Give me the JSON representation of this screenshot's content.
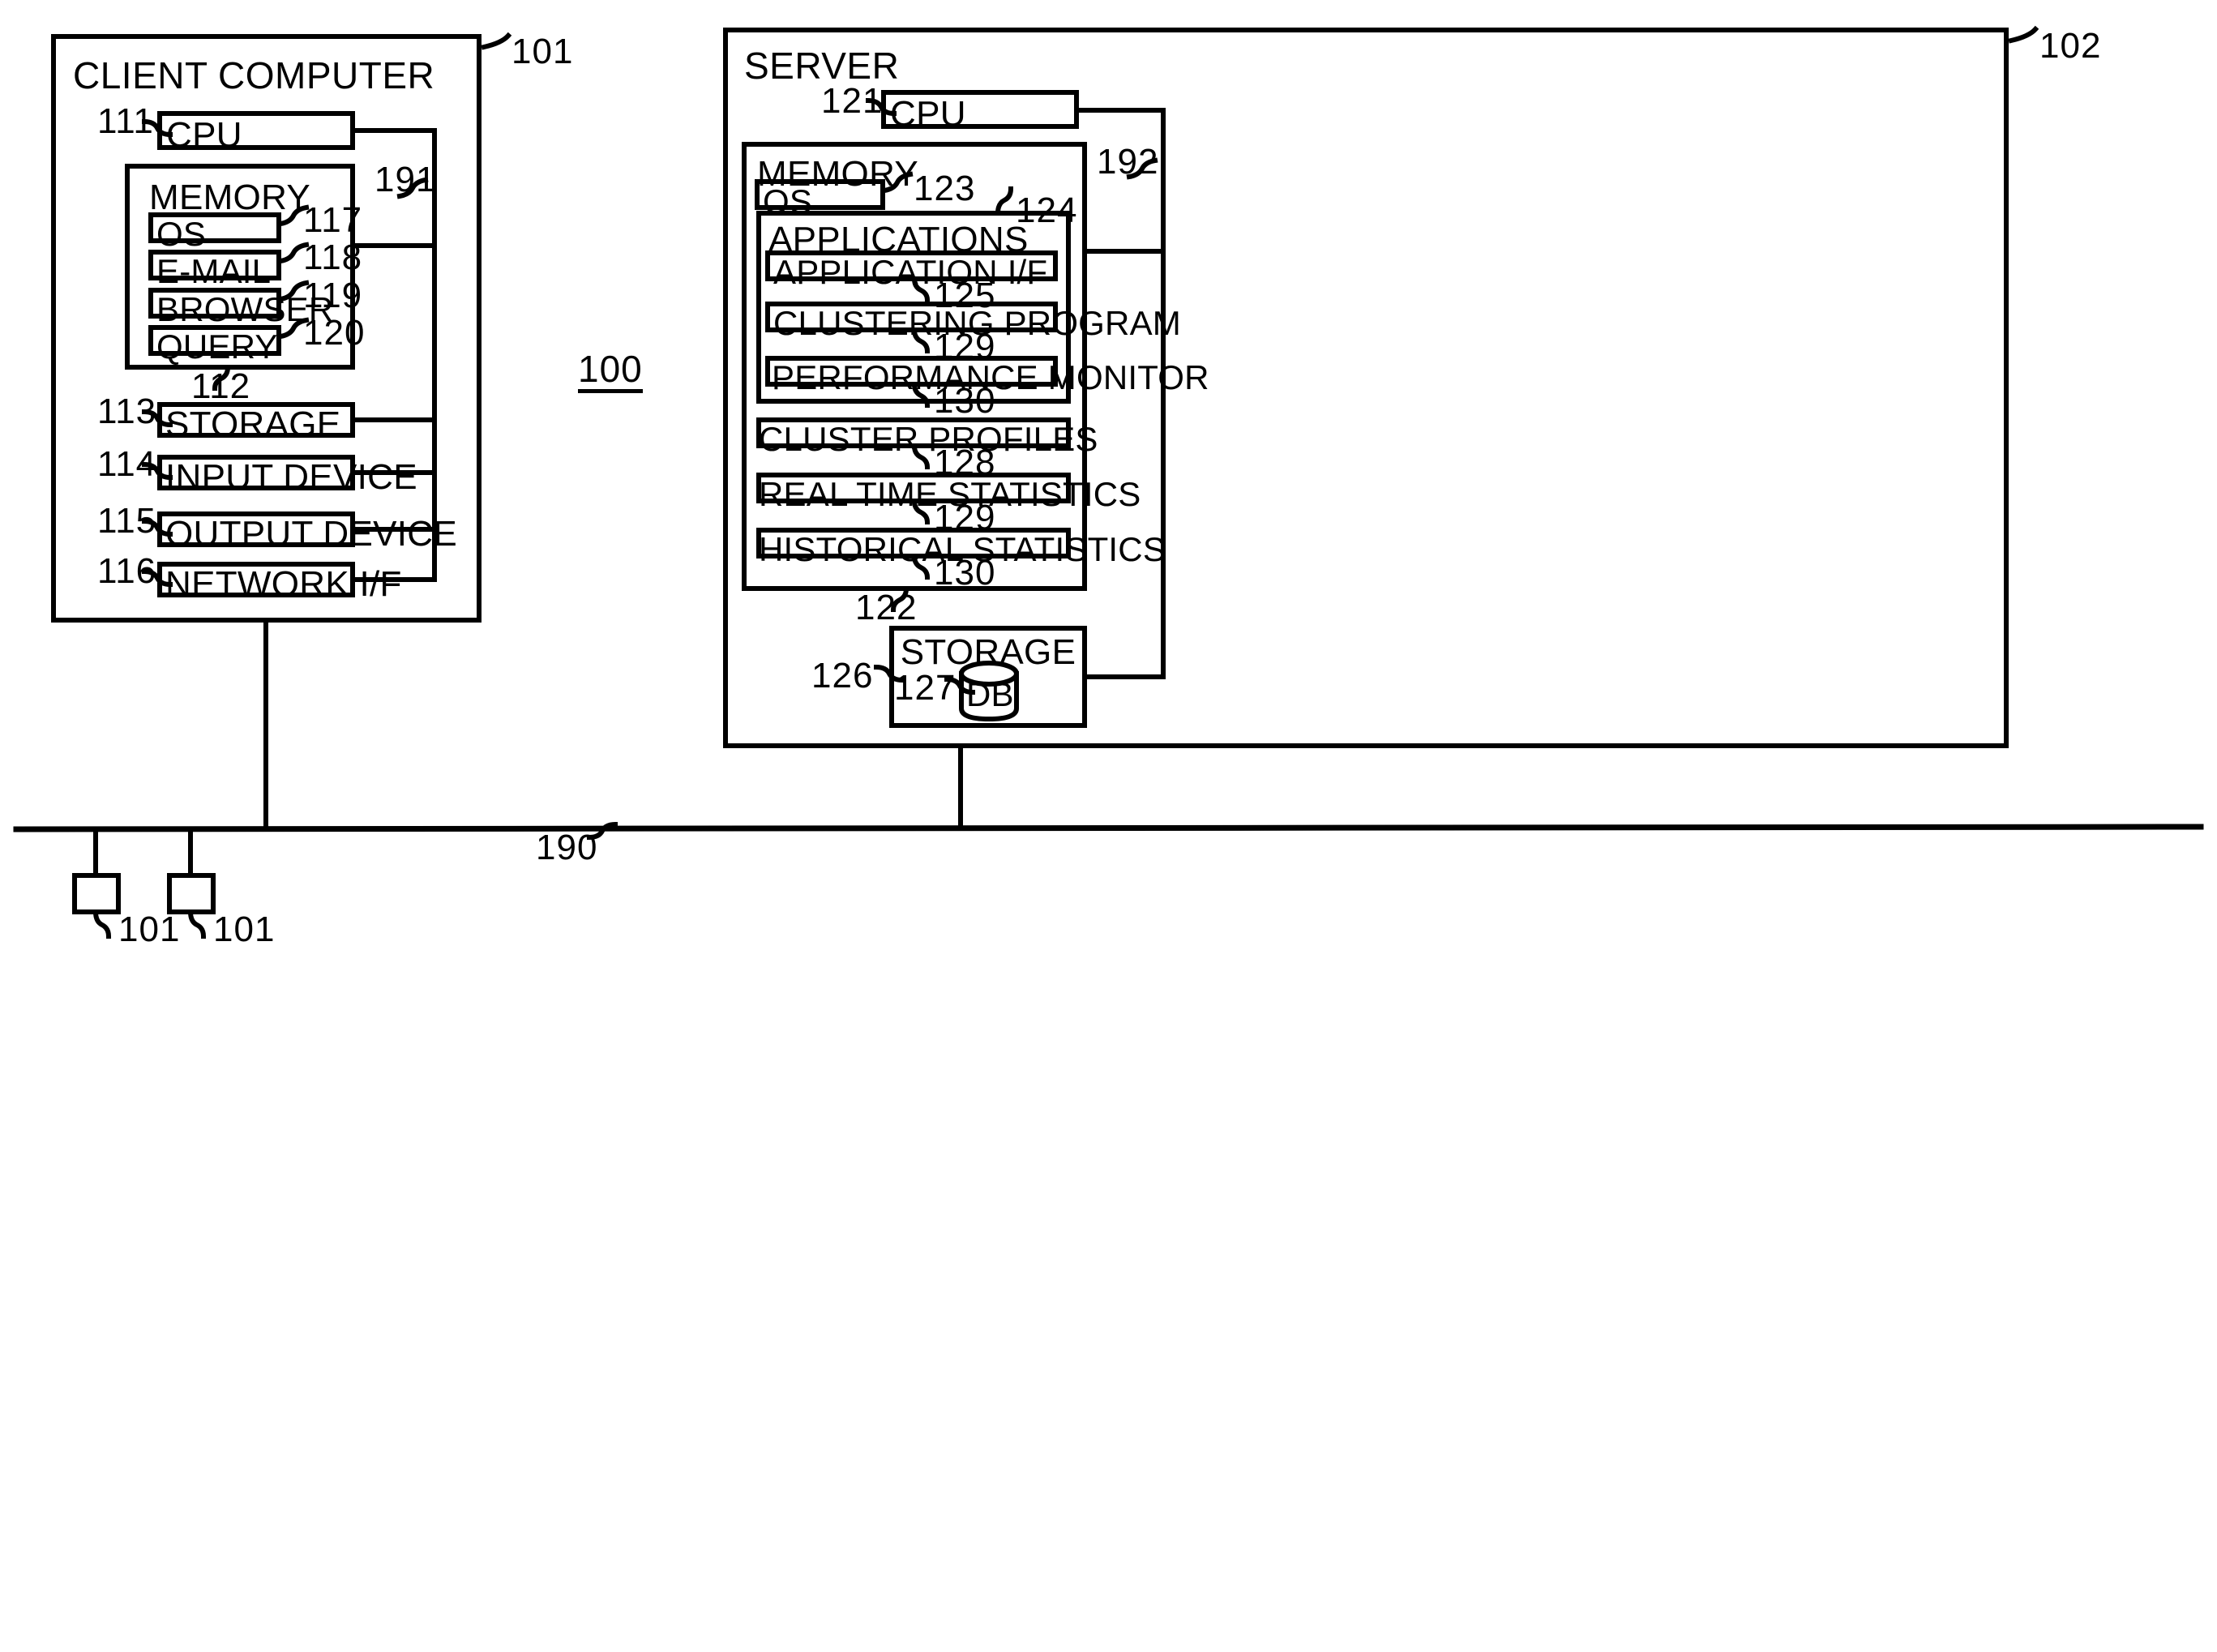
{
  "figure": {
    "system_ref": "100",
    "network_ref": "190",
    "client": {
      "title": "CLIENT COMPUTER",
      "ref": "101",
      "bus_ref": "191",
      "cpu": {
        "label": "CPU",
        "ref": "111"
      },
      "memory": {
        "label": "MEMORY",
        "ref": "112",
        "items": [
          {
            "label": "OS",
            "ref": "117"
          },
          {
            "label": "E-MAIL",
            "ref": "118"
          },
          {
            "label": "BROWSER",
            "ref": "119"
          },
          {
            "label": "QUERY",
            "ref": "120"
          }
        ]
      },
      "devices": [
        {
          "label": "STORAGE",
          "ref": "113"
        },
        {
          "label": "INPUT DEVICE",
          "ref": "114"
        },
        {
          "label": "OUTPUT DEVICE",
          "ref": "115"
        },
        {
          "label": "NETWORK I/F",
          "ref": "116"
        }
      ]
    },
    "server": {
      "title": "SERVER",
      "ref": "102",
      "bus_ref": "192",
      "cpu": {
        "label": "CPU",
        "ref": "121"
      },
      "memory": {
        "label": "MEMORY",
        "ref": "122",
        "os": {
          "label": "OS",
          "ref": "123"
        },
        "applications": {
          "label": "APPLICATIONS",
          "ref": "124",
          "items": [
            {
              "label": "APPLICATION I/F",
              "ref": "125"
            },
            {
              "label": "CLUSTERING PROGRAM",
              "ref": "129"
            },
            {
              "label": "PERFORMANCE MONITOR",
              "ref": "130"
            }
          ]
        },
        "data_items": [
          {
            "label": "CLUSTER PROFILES",
            "ref": "128"
          },
          {
            "label": "REAL TIME STATISTICS",
            "ref": "129"
          },
          {
            "label": "HISTORICAL STATISTICS",
            "ref": "130"
          }
        ]
      },
      "storage": {
        "label": "STORAGE",
        "ref": "126",
        "db": {
          "label": "DB",
          "ref": "127"
        }
      }
    },
    "extra_clients": [
      {
        "ref": "101"
      },
      {
        "ref": "101"
      }
    ]
  }
}
